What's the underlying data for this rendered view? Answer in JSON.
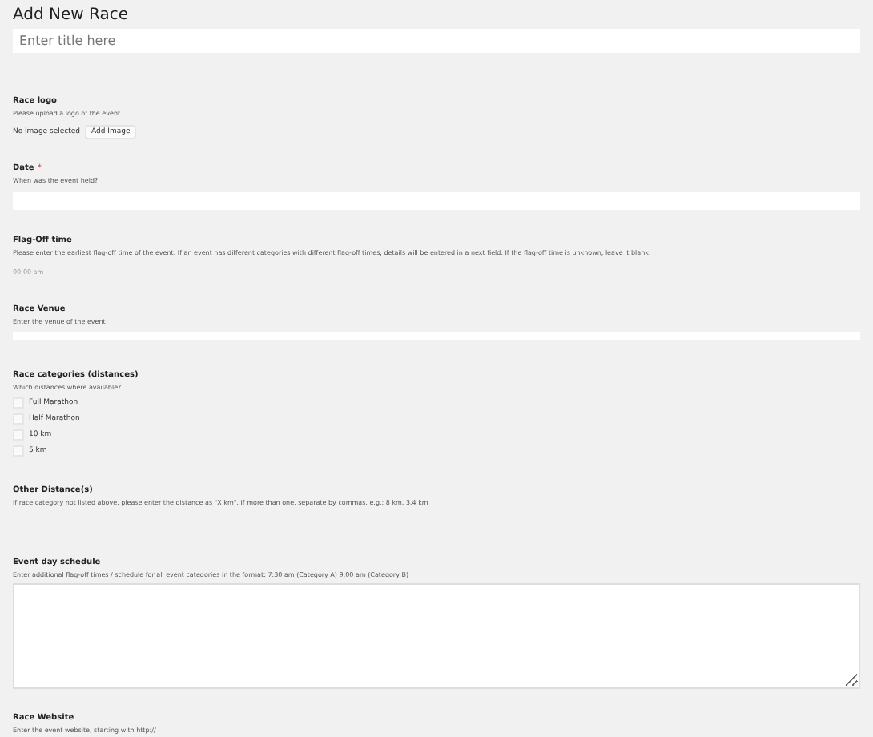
{
  "page_title": "Add New Race",
  "title_field": {
    "placeholder": "Enter title here"
  },
  "fields": [
    {
      "kind": "image",
      "label": "Race logo",
      "description": "Please upload a logo of the event",
      "status": "No image selected",
      "button": "Add Image"
    },
    {
      "kind": "text",
      "label": "Date",
      "required_mark": "*",
      "description": "When was the event held?"
    },
    {
      "kind": "time",
      "label": "Flag-Off time",
      "description": "Please enter the earliest flag-off time of the event. If an event has different categories with different flag-off times, details will be entered in a next field. If the flag-off time is unknown, leave it blank.",
      "placeholder": "00:00 am"
    },
    {
      "kind": "thin",
      "label": "Race Venue",
      "description": "Enter the venue of the event"
    },
    {
      "kind": "checkboxes",
      "label": "Race categories (distances)",
      "description": "Which distances where available?",
      "options": [
        {
          "label": "Full Marathon",
          "checked": false
        },
        {
          "label": "Half Marathon",
          "checked": false
        },
        {
          "label": "10 km",
          "checked": false
        },
        {
          "label": "5 km",
          "checked": false
        }
      ]
    },
    {
      "kind": "none",
      "label": "Other Distance(s)",
      "description": "If race category not listed above, please enter the distance as \"X km\". If more than one, separate by commas, e.g.: 8 km, 3.4 km"
    },
    {
      "kind": "textarea",
      "label": "Event day schedule",
      "description": "Enter additional flag-off times / schedule for all event categories in the format: 7:30 am (Category A) 9:00 am (Category B)"
    },
    {
      "kind": "none",
      "label": "Race Website",
      "description": "Enter the event website, starting with http://"
    }
  ]
}
